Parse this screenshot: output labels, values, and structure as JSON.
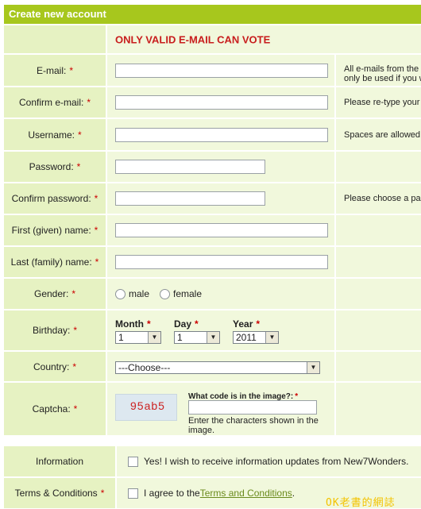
{
  "header": {
    "title": "Create new account"
  },
  "notice": "ONLY VALID E-MAIL CAN VOTE",
  "fields": {
    "email": {
      "label": "E-mail:",
      "hint": "All e-mails from the s",
      "hint2": "only be used if you w"
    },
    "confirm_email": {
      "label": "Confirm e-mail:",
      "hint": "Please re-type your"
    },
    "username": {
      "label": "Username:",
      "hint": "Spaces are allowed;"
    },
    "password": {
      "label": "Password:"
    },
    "confirm_password": {
      "label": "Confirm password:",
      "hint": "Please choose a pas"
    },
    "first_name": {
      "label": "First (given) name:"
    },
    "last_name": {
      "label": "Last (family) name:"
    },
    "gender": {
      "label": "Gender:",
      "male": "male",
      "female": "female"
    },
    "birthday": {
      "label": "Birthday:",
      "month_label": "Month",
      "month_value": "1",
      "day_label": "Day",
      "day_value": "1",
      "year_label": "Year",
      "year_value": "2011"
    },
    "country": {
      "label": "Country:",
      "value": "---Choose---"
    },
    "captcha": {
      "label": "Captcha:",
      "image_text": "95ab5",
      "question": "What code is in the image?:",
      "help": "Enter the characters shown in the image."
    }
  },
  "required_mark": "*",
  "information": {
    "label": "Information",
    "text": "Yes! I wish to receive information updates from New7Wonders."
  },
  "terms": {
    "label": "Terms & Conditions",
    "text_before": "I agree to the ",
    "link": "Terms and Conditions",
    "text_after": "."
  },
  "watermark": "OK老書的網誌"
}
